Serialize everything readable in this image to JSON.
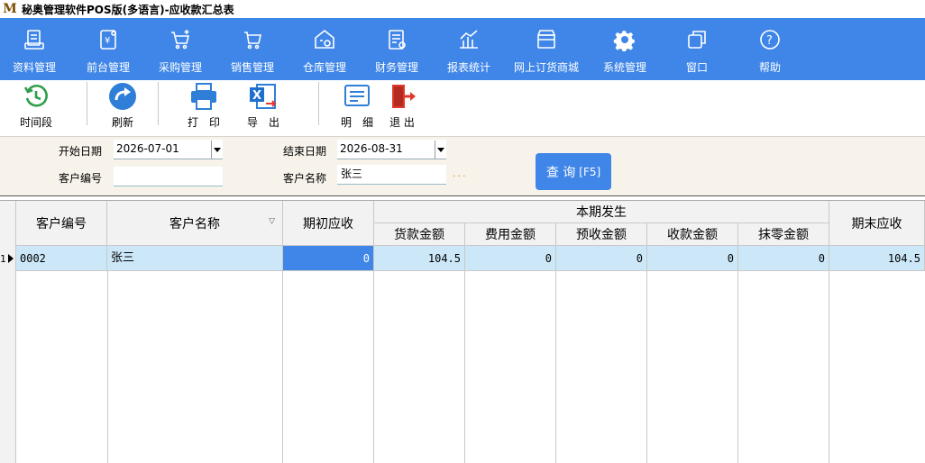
{
  "window": {
    "title": "秘奥管理软件POS版(多语言)-应收款汇总表",
    "logo": "M"
  },
  "menu": [
    {
      "label": "资料管理",
      "icon": "document-icon"
    },
    {
      "label": "前台管理",
      "icon": "cashier-icon"
    },
    {
      "label": "采购管理",
      "icon": "cart-plus-icon"
    },
    {
      "label": "销售管理",
      "icon": "cart-icon"
    },
    {
      "label": "仓库管理",
      "icon": "warehouse-icon"
    },
    {
      "label": "财务管理",
      "icon": "finance-icon"
    },
    {
      "label": "报表统计",
      "icon": "chart-icon"
    },
    {
      "label": "网上订货商城",
      "icon": "store-icon"
    },
    {
      "label": "系统管理",
      "icon": "gear-icon"
    },
    {
      "label": "窗口",
      "icon": "window-icon"
    },
    {
      "label": "帮助",
      "icon": "help-icon"
    }
  ],
  "toolbar": {
    "period": "时间段",
    "refresh": "刷新",
    "print": "打　印",
    "export": "导　出",
    "detail": "明　细",
    "exit": "退 出"
  },
  "filter": {
    "start_label": "开始日期",
    "start_value": "2026-07-01",
    "end_label": "结束日期",
    "end_value": "2026-08-31",
    "customer_code_label": "客户编号",
    "customer_code_value": "",
    "customer_name_label": "客户名称",
    "customer_name_value": "张三",
    "ellipsis": "...",
    "query_label": "查 询",
    "query_key": "[F5]"
  },
  "table": {
    "headers": {
      "customer_code": "客户编号",
      "customer_name": "客户名称",
      "opening": "期初应收",
      "period_group": "本期发生",
      "goods_amount": "货款金额",
      "fee_amount": "费用金额",
      "prepaid_amount": "预收金额",
      "received_amount": "收款金额",
      "writeoff_amount": "抹零金额",
      "closing": "期末应收"
    },
    "rows": [
      {
        "index": "1",
        "customer_code": "0002",
        "customer_name": "张三",
        "opening": "0",
        "goods_amount": "104.5",
        "fee_amount": "0",
        "prepaid_amount": "0",
        "received_amount": "0",
        "writeoff_amount": "0",
        "closing": "104.5"
      }
    ]
  },
  "colors": {
    "accent": "#3f86e8",
    "row_highlight": "#cce8f8",
    "filter_bg": "#f7f3ea",
    "exit_red": "#e03a2e",
    "refresh_green": "#2e9e4a"
  }
}
